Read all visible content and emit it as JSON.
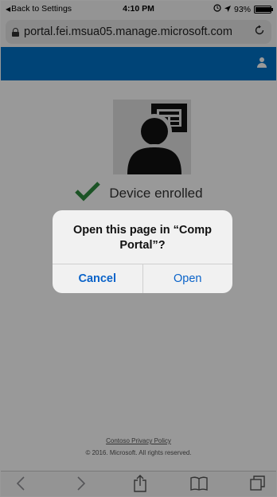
{
  "status_bar": {
    "back_label": "Back to Settings",
    "time": "4:10 PM",
    "battery": "93%",
    "battery_level": 0.93
  },
  "url_bar": {
    "url": "portal.fei.msua05.manage.microsoft.com"
  },
  "page": {
    "status_text": "Device enrolled",
    "privacy_link": "Contoso Privacy Policy",
    "copyright": "© 2016. Microsoft. All rights reserved."
  },
  "alert": {
    "message": "Open this page in “Comp Portal”?",
    "cancel_label": "Cancel",
    "open_label": "Open"
  },
  "colors": {
    "header_blue": "#0072c6",
    "check_green": "#2e8b3e",
    "ios_blue": "#0a63c9"
  }
}
